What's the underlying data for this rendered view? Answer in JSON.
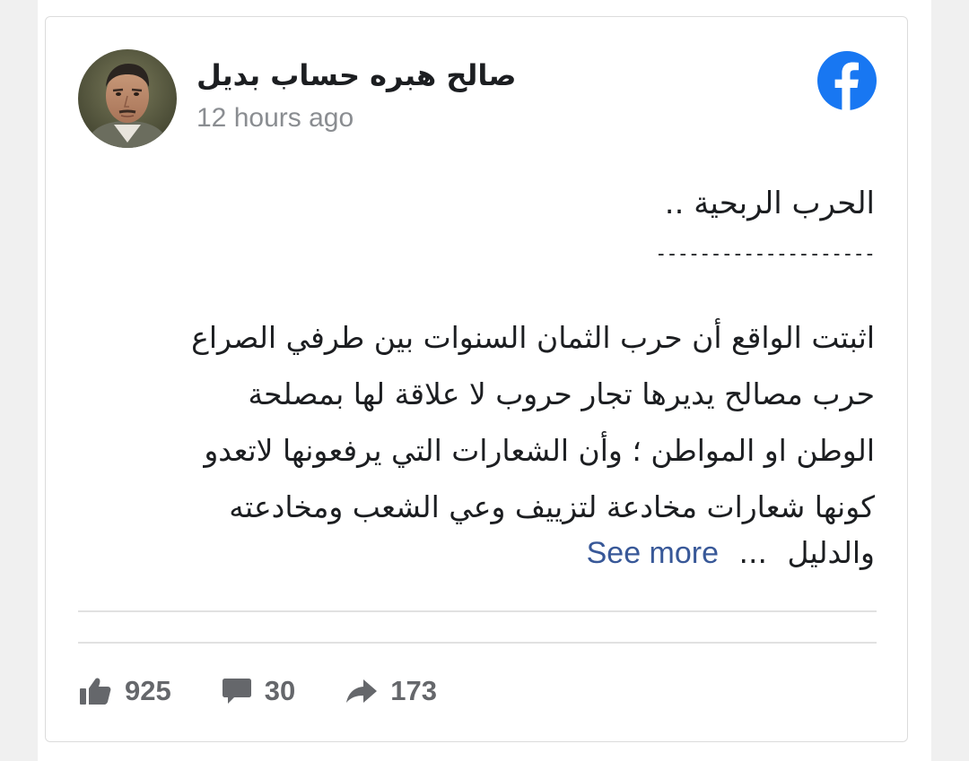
{
  "post": {
    "author_name": "صالح هبره حساب بديل",
    "timestamp": "12 hours ago",
    "title": "الحرب الربحية ..",
    "divider": "--------------------",
    "body_lines": [
      "اثبتت الواقع أن حرب الثمان السنوات بين طرفي الصراع",
      "حرب مصالح يديرها تجار حروب لا علاقة لها بمصلحة",
      "الوطن او المواطن ؛ وأن الشعارات التي يرفعونها لاتعدو",
      "كونها شعارات مخادعة لتزييف وعي الشعب ومخادعته"
    ],
    "last_line_start": "والدليل",
    "ellipsis": "...",
    "see_more_label": "See more"
  },
  "stats": {
    "likes": "925",
    "comments": "30",
    "shares": "173"
  },
  "icons": {
    "platform": "facebook-logo-icon",
    "like": "thumbs-up-icon",
    "comment": "comment-bubble-icon",
    "share": "share-arrow-icon"
  },
  "colors": {
    "facebook_blue": "#1877f2",
    "link_blue": "#385898",
    "muted_gray": "#65676b",
    "timestamp_gray": "#8a8d91"
  }
}
